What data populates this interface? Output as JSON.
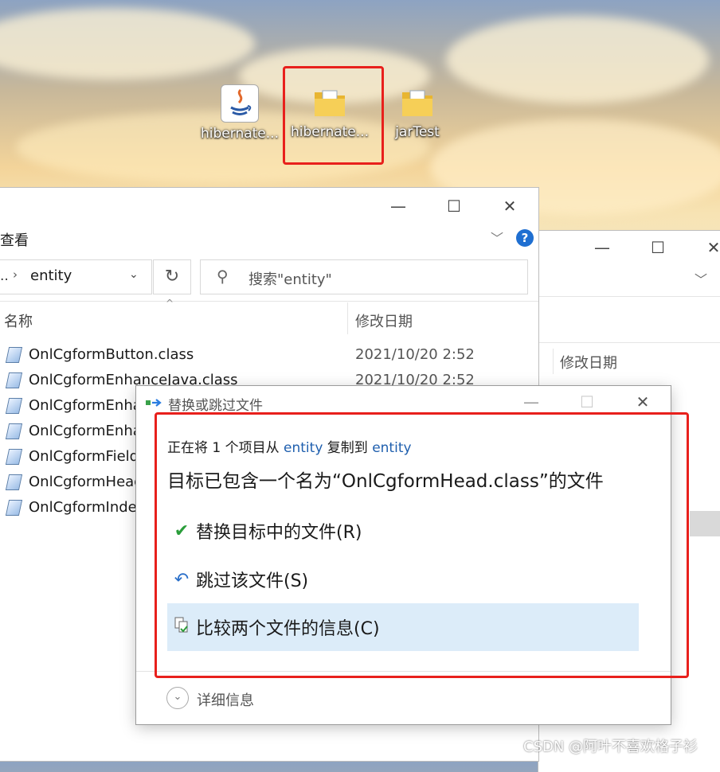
{
  "desktop": {
    "icons": [
      {
        "label": "hibernate...",
        "icon": "java-icon"
      },
      {
        "label": "hibernate...",
        "icon": "folder-icon"
      },
      {
        "label": "jarTest",
        "icon": "folder-icon"
      }
    ]
  },
  "explorer": {
    "menu_label": "查看",
    "help_icon": "?",
    "address_ellipsis": "..",
    "address_current": "entity",
    "search_placeholder": "搜索\"entity\"",
    "columns": {
      "name": "名称",
      "date": "修改日期"
    },
    "files": [
      {
        "name": "OnlCgformButton.class",
        "date": "2021/10/20 2:52"
      },
      {
        "name": "OnlCgformEnhanceJava.class",
        "date": "2021/10/20 2:52"
      },
      {
        "name": "OnlCgformEnha",
        "date": ""
      },
      {
        "name": "OnlCgformEnha",
        "date": ""
      },
      {
        "name": "OnlCgformField",
        "date": ""
      },
      {
        "name": "OnlCgformHead",
        "date": ""
      },
      {
        "name": "OnlCgformIndex",
        "date": ""
      }
    ]
  },
  "explorer2": {
    "date_column": "修改日期"
  },
  "dialog": {
    "title": "替换或跳过文件",
    "copy_prefix": "正在将 1 个项目从 ",
    "source": "entity",
    "copy_mid": " 复制到 ",
    "target": "entity",
    "heading": "目标已包含一个名为“OnlCgformHead.class”的文件",
    "options": [
      {
        "label": "替换目标中的文件(R)",
        "icon": "check-icon"
      },
      {
        "label": "跳过该文件(S)",
        "icon": "undo-icon"
      },
      {
        "label": "比较两个文件的信息(C)",
        "icon": "compare-icon"
      }
    ],
    "details_label": "详细信息"
  },
  "watermark": "CSDN @阿叶不喜欢格子衫",
  "colors": {
    "highlight": "#e8201c",
    "link": "#1f5fae",
    "check": "#2a9d3a",
    "selected_option_bg": "#dcecf9"
  }
}
